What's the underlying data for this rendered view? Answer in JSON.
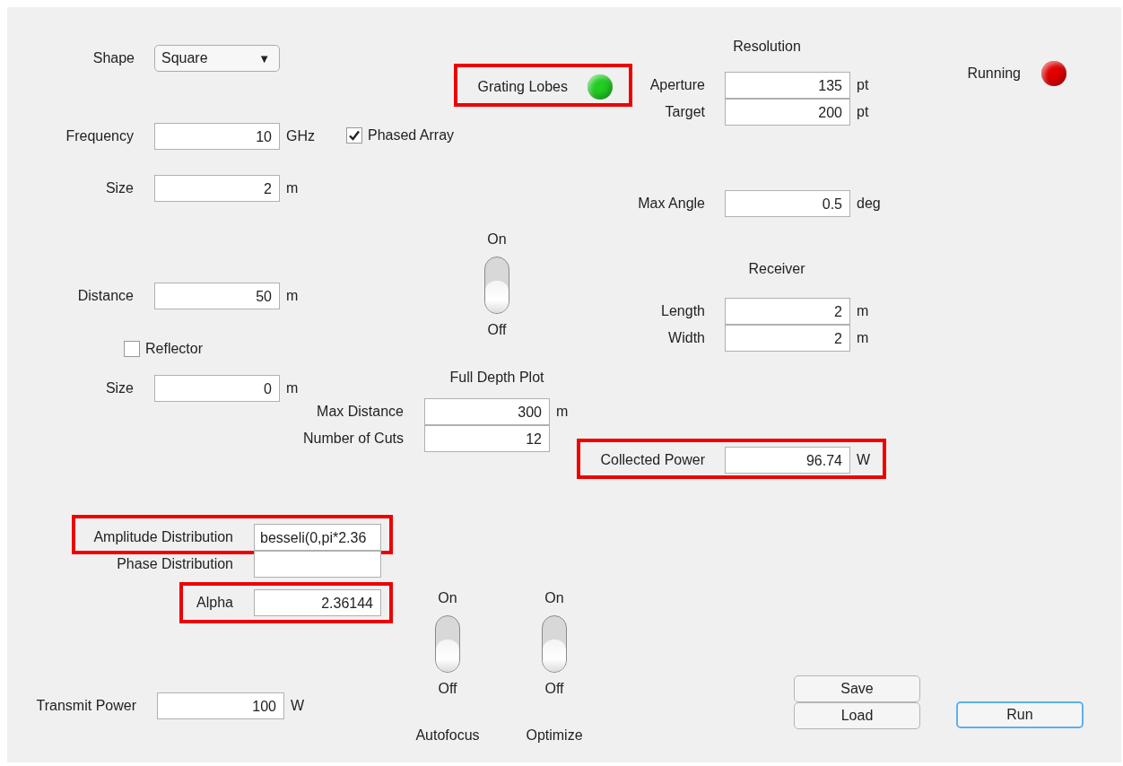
{
  "controls": [
    {
      "kind": "dropdown",
      "label": "Shape",
      "value": "Square",
      "caret": "▼"
    },
    {
      "kind": "field",
      "label": "Frequency",
      "value": "10",
      "unit": "GHz"
    },
    {
      "kind": "checkbox",
      "label": "Phased Array",
      "checked": true
    },
    {
      "kind": "field",
      "label": "Size",
      "value": "2",
      "unit": "m"
    },
    {
      "kind": "field",
      "label": "Distance",
      "value": "50",
      "unit": "m"
    },
    {
      "kind": "checkbox",
      "label": "Reflector",
      "checked": false
    },
    {
      "kind": "field",
      "label": "Size",
      "value": "0",
      "unit": "m"
    },
    {
      "kind": "lamp",
      "label": "Grating Lobes",
      "color": "#22cc22",
      "highlighted": true
    },
    {
      "kind": "heading",
      "label": "Resolution"
    },
    {
      "kind": "field",
      "label": "Aperture",
      "value": "135",
      "unit": "pt"
    },
    {
      "kind": "field",
      "label": "Target",
      "value": "200",
      "unit": "pt"
    },
    {
      "kind": "field",
      "label": "Max Angle",
      "value": "0.5",
      "unit": "deg"
    },
    {
      "kind": "lamp",
      "label": "Running",
      "color": "#e00000"
    },
    {
      "kind": "toggle",
      "on_label": "On",
      "off_label": "Off",
      "on": false
    },
    {
      "kind": "heading",
      "label": "Receiver"
    },
    {
      "kind": "field",
      "label": "Length",
      "value": "2",
      "unit": "m"
    },
    {
      "kind": "field",
      "label": "Width",
      "value": "2",
      "unit": "m"
    },
    {
      "kind": "heading",
      "label": "Full Depth Plot"
    },
    {
      "kind": "field",
      "label": "Max Distance",
      "value": "300",
      "unit": "m"
    },
    {
      "kind": "field",
      "label": "Number of Cuts",
      "value": "12"
    },
    {
      "kind": "field",
      "label": "Collected Power",
      "value": "96.74",
      "unit": "W",
      "highlighted": true
    },
    {
      "kind": "text_field",
      "label": "Amplitude Distribution",
      "value": "besseli(0,pi*2.36",
      "highlighted": true
    },
    {
      "kind": "text_field",
      "label": "Phase Distribution"
    },
    {
      "kind": "field",
      "label": "Alpha",
      "value": "2.36144",
      "highlighted": true
    },
    {
      "kind": "toggle",
      "on_label": "On",
      "off_label": "Off",
      "caption": "Autofocus",
      "on": false
    },
    {
      "kind": "toggle",
      "on_label": "On",
      "off_label": "Off",
      "caption": "Optimize",
      "on": false
    },
    {
      "kind": "field",
      "label": "Transmit Power",
      "value": "100",
      "unit": "W"
    },
    {
      "kind": "button",
      "label": "Save",
      "focused": false
    },
    {
      "kind": "button",
      "label": "Load",
      "focused": false
    },
    {
      "kind": "button",
      "label": "Run",
      "focused": true
    }
  ]
}
